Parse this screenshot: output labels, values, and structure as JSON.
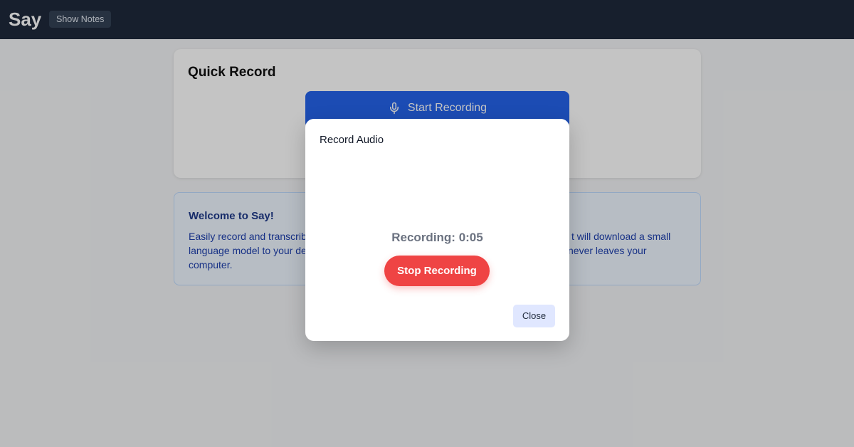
{
  "topbar": {
    "brand": "Say",
    "show_notes_label": "Show Notes"
  },
  "quick_record": {
    "title": "Quick Record",
    "start_label": "Start Recording",
    "start_icon": "microphone-icon"
  },
  "welcome": {
    "title": "Welcome to Say!",
    "text_line1_left": "Easily record and transcribe",
    "text_line1_right": "t will download a small",
    "text_line2_left": "language model to your dev",
    "text_line2_right": "never leaves your",
    "text_line3": "computer."
  },
  "modal": {
    "title": "Record Audio",
    "status": "Recording: 0:05",
    "stop_label": "Stop Recording",
    "close_label": "Close"
  },
  "colors": {
    "topbar": "#1e293b",
    "primary": "#2563eb",
    "danger": "#ef4444",
    "info_bg": "#eff6ff"
  }
}
